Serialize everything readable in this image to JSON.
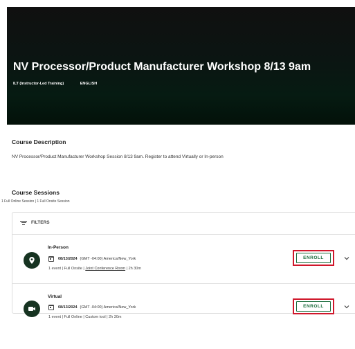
{
  "course": {
    "title": "NV Processor/Product Manufacturer Workshop 8/13 9am",
    "tags": [
      "ILT (Instructor-Led Training)",
      "ENGLISH"
    ]
  },
  "description": {
    "heading": "Course Description",
    "text": "NV Processor/Product Manufacturer Workshop Session 8/13 9am. Register to attend Virtually or In-person"
  },
  "sessions": {
    "heading": "Course Sessions",
    "summary": "1 Full Online Session | 1 Full Onsite Session",
    "filters_label": "FILTERS",
    "items": [
      {
        "type": "In-Person",
        "icon": "location-pin-icon",
        "date": "08/13/2024",
        "timezone": "(GMT -04:00) America/New_York",
        "meta_prefix": "1 event | Full Onsite | ",
        "location_link": "Joint Conference Room",
        "meta_suffix": " | 2h 30m",
        "enroll_label": "ENROLL"
      },
      {
        "type": "Virtual",
        "icon": "video-camera-icon",
        "date": "08/13/2024",
        "timezone": "(GMT -04:00) America/New_York",
        "meta": "1 event | Full Online | Custom tool | 2h 30m",
        "enroll_label": "ENROLL"
      }
    ]
  },
  "colors": {
    "hero_dark": "#061b12",
    "accent_green": "#1b6d3c",
    "icon_circle": "#163321",
    "highlight_red": "#d0172b"
  }
}
